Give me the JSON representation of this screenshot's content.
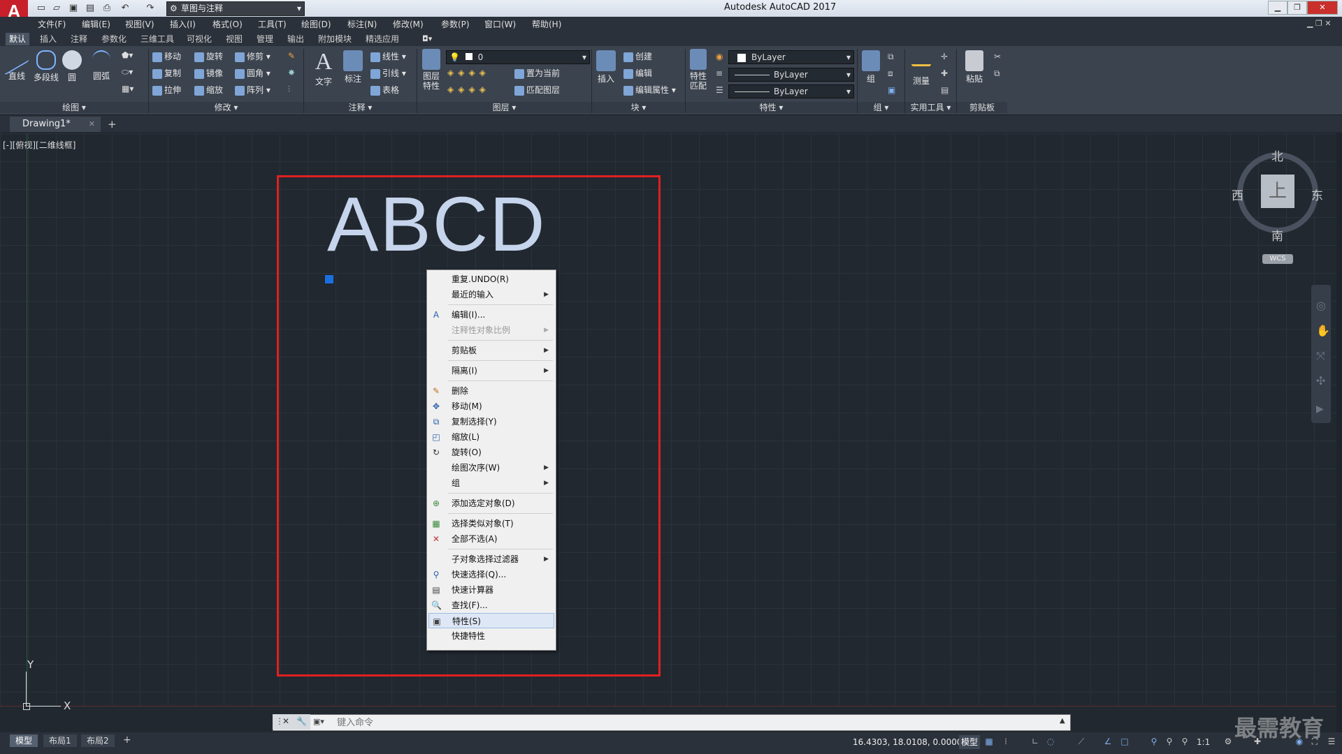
{
  "titlebar": {
    "title": "Autodesk AutoCAD 2017",
    "logo": "A",
    "workspace": "草图与注释",
    "quick_access_icons": [
      "new-icon",
      "open-icon",
      "save-icon",
      "saveas-icon",
      "print-icon",
      "undo-icon",
      "redo-icon"
    ],
    "window_buttons": [
      "minimize-icon",
      "restore-icon",
      "close-icon"
    ]
  },
  "menubar": {
    "items": [
      "文件(F)",
      "编辑(E)",
      "视图(V)",
      "插入(I)",
      "格式(O)",
      "工具(T)",
      "绘图(D)",
      "标注(N)",
      "修改(M)",
      "参数(P)",
      "窗口(W)",
      "帮助(H)"
    ]
  },
  "ribbon_tabs": {
    "items": [
      "默认",
      "插入",
      "注释",
      "参数化",
      "三维工具",
      "可视化",
      "视图",
      "管理",
      "输出",
      "附加模块",
      "精选应用"
    ],
    "active_index": 0
  },
  "ribbon": {
    "draw": {
      "title": "绘图",
      "line": "直线",
      "polyline": "多段线",
      "circle": "圆",
      "arc": "圆弧"
    },
    "modify": {
      "title": "修改",
      "move": "移动",
      "rotate": "旋转",
      "trim": "修剪",
      "copy": "复制",
      "mirror": "镜像",
      "fillet": "圆角",
      "stretch": "拉伸",
      "scale": "缩放",
      "array": "阵列"
    },
    "annotation": {
      "title": "注释",
      "text": "文字",
      "dimension": "标注",
      "linear": "线性",
      "leader": "引线",
      "table": "表格"
    },
    "layers": {
      "title": "图层",
      "layer_props": "图层特性",
      "current_layer": "0",
      "set_current": "置为当前",
      "match_layer": "匹配图层"
    },
    "block": {
      "title": "块",
      "insert": "插入",
      "create": "创建",
      "edit": "编辑",
      "edit_attr": "编辑属性"
    },
    "properties": {
      "title": "特性",
      "match": "特性匹配",
      "color": "ByLayer",
      "linetype": "ByLayer",
      "lineweight": "ByLayer"
    },
    "groups": {
      "title": "组",
      "group": "组"
    },
    "utilities": {
      "title": "实用工具",
      "measure": "测量"
    },
    "clipboard": {
      "title": "剪贴板",
      "paste": "粘贴"
    }
  },
  "file_tab": {
    "name": "Drawing1*"
  },
  "viewport": {
    "label": "[-][俯视][二维线框]"
  },
  "drawing": {
    "text": "ABCD",
    "box_color": "#e02020",
    "text_color": "#c6d4ec"
  },
  "context_menu": {
    "items": [
      {
        "label": "重复.UNDO(R)",
        "submenu": false,
        "icon": ""
      },
      {
        "label": "最近的输入",
        "submenu": true,
        "icon": ""
      },
      {
        "label": "编辑(I)...",
        "submenu": false,
        "icon": "edit-text-icon"
      },
      {
        "label": "注释性对象比例",
        "submenu": true,
        "icon": "",
        "disabled": true
      },
      {
        "label": "剪贴板",
        "submenu": true,
        "icon": ""
      },
      {
        "label": "隔离(I)",
        "submenu": true,
        "icon": ""
      },
      {
        "label": "删除",
        "submenu": false,
        "icon": "erase-icon"
      },
      {
        "label": "移动(M)",
        "submenu": false,
        "icon": "move-icon"
      },
      {
        "label": "复制选择(Y)",
        "submenu": false,
        "icon": "copy-icon"
      },
      {
        "label": "缩放(L)",
        "submenu": false,
        "icon": "scale-icon"
      },
      {
        "label": "旋转(O)",
        "submenu": false,
        "icon": "rotate-icon"
      },
      {
        "label": "绘图次序(W)",
        "submenu": true,
        "icon": ""
      },
      {
        "label": "组",
        "submenu": true,
        "icon": ""
      },
      {
        "label": "添加选定对象(D)",
        "submenu": false,
        "icon": "add-selected-icon"
      },
      {
        "label": "选择类似对象(T)",
        "submenu": false,
        "icon": "select-similar-icon"
      },
      {
        "label": "全部不选(A)",
        "submenu": false,
        "icon": "deselect-icon"
      },
      {
        "label": "子对象选择过滤器",
        "submenu": true,
        "icon": ""
      },
      {
        "label": "快速选择(Q)...",
        "submenu": false,
        "icon": "quick-select-icon"
      },
      {
        "label": "快速计算器",
        "submenu": false,
        "icon": "calculator-icon"
      },
      {
        "label": "查找(F)...",
        "submenu": false,
        "icon": "find-icon"
      },
      {
        "label": "特性(S)",
        "submenu": false,
        "icon": "properties-icon",
        "highlighted": true
      },
      {
        "label": "快捷特性",
        "submenu": false,
        "icon": ""
      }
    ]
  },
  "viewcube": {
    "north": "北",
    "south": "南",
    "east": "东",
    "west": "西",
    "face": "上",
    "wcs": "WCS"
  },
  "ucs": {
    "x": "X",
    "y": "Y"
  },
  "command_line": {
    "placeholder": "键入命令"
  },
  "layout_tabs": {
    "items": [
      "模型",
      "布局1",
      "布局2"
    ],
    "active_index": 0,
    "add": "+"
  },
  "status": {
    "coordinates": "16.4303, 18.0108, 0.0000",
    "model": "模型",
    "scale": "1:1"
  },
  "watermark": "最需教育"
}
